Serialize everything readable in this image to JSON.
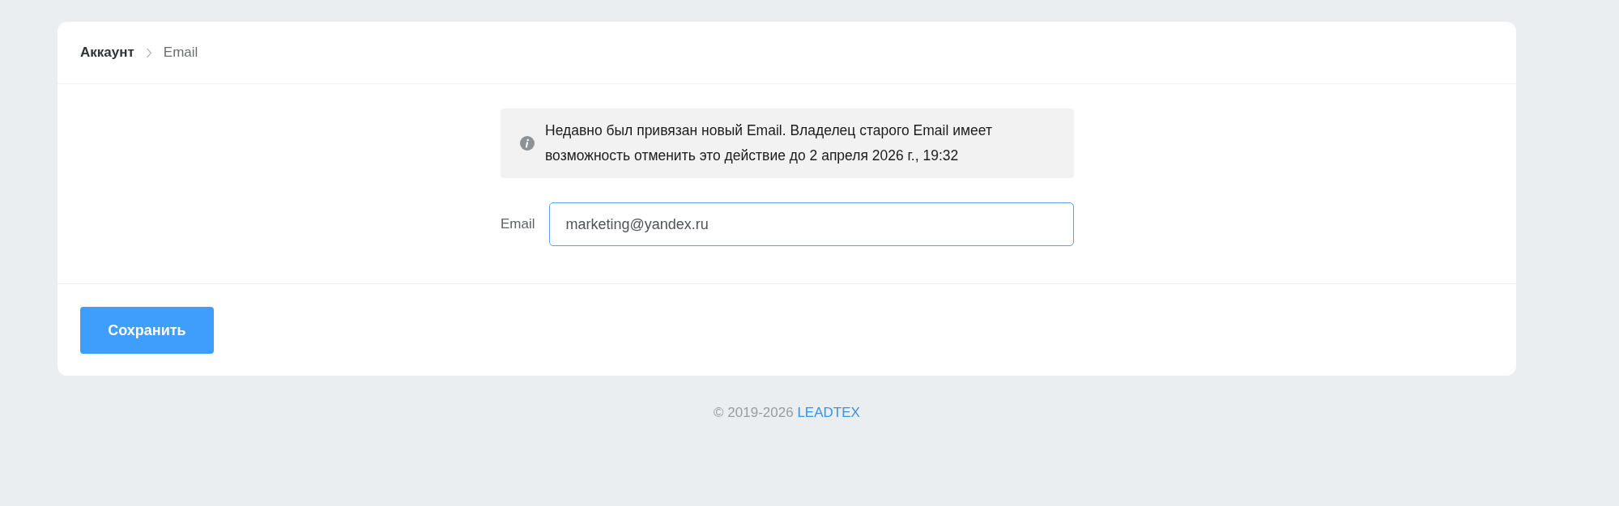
{
  "breadcrumbs": [
    {
      "label": "Аккаунт",
      "current": false
    },
    {
      "label": "Email",
      "current": true
    }
  ],
  "notice": {
    "text": "Недавно был привязан новый Email. Владелец старого Email имеет возможность отменить это действие до 2 апреля 2026 г., 19:32"
  },
  "email_field": {
    "label": "Email",
    "value": "marketing@yandex.ru",
    "focused": true
  },
  "save_button": {
    "label": "Сохранить"
  },
  "footer": {
    "copyright": "© 2019-2026",
    "brand": "LEADTEX"
  }
}
